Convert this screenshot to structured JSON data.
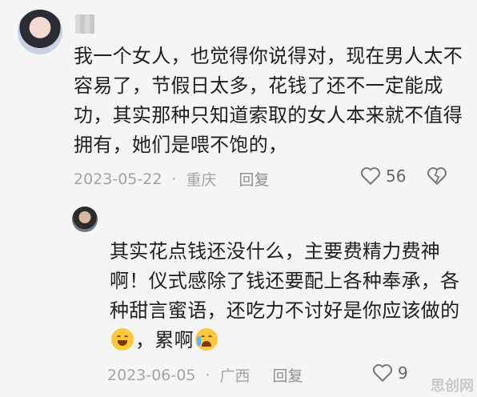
{
  "comments": [
    {
      "text": "我一个女人，也觉得你说得对，现在男人太不容易了，节假日太多，花钱了还不一定能成功，其实那种只知道索取的女人本来就不值得拥有，她们是喂不饱的，",
      "date": "2023-05-22",
      "location": "重庆",
      "reply_label": "回复",
      "likes": "56"
    },
    {
      "text_part1": "其实花点钱还没什么，主要费精力费神啊！仪式感除了钱还要配上各种奉承，各种甜言蜜语，还吃力不讨好是你应该做的",
      "text_part2": "，累啊",
      "date": "2023-06-05",
      "location": "广西",
      "reply_label": "回复",
      "likes": "9"
    }
  ],
  "watermark": "思创网",
  "icons": {
    "like": "heart-icon",
    "dislike": "broken-heart-icon"
  }
}
